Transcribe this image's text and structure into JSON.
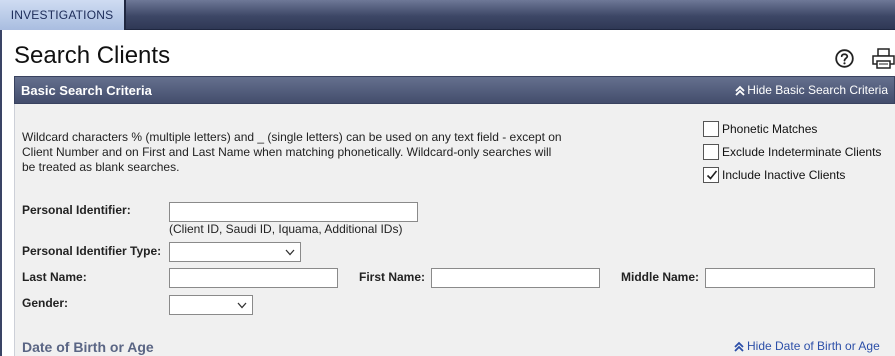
{
  "nav": {
    "tab_label": "INVESTIGATIONS"
  },
  "page": {
    "title": "Search Clients"
  },
  "icons": {
    "help": "help-circle-icon",
    "print": "printer-icon"
  },
  "basic_search": {
    "title": "Basic Search Criteria",
    "hide_label": "Hide Basic Search Criteria",
    "description": "Wildcard characters % (multiple letters) and _ (single letters) can be used on any text field - except on Client Number and on First and Last Name when matching phonetically. Wildcard-only searches will be treated as blank searches.",
    "options": [
      {
        "label": "Phonetic Matches",
        "checked": false
      },
      {
        "label": "Exclude Indeterminate Clients",
        "checked": false
      },
      {
        "label": "Include Inactive Clients",
        "checked": true
      }
    ],
    "fields": {
      "personal_identifier": {
        "label": "Personal Identifier:",
        "value": "",
        "hint": "(Client ID, Saudi ID, Iquama, Additional IDs)"
      },
      "personal_identifier_type": {
        "label": "Personal Identifier Type:",
        "value": ""
      },
      "last_name": {
        "label": "Last Name:",
        "value": ""
      },
      "first_name": {
        "label": "First Name:",
        "value": ""
      },
      "middle_name": {
        "label": "Middle Name:",
        "value": ""
      },
      "gender": {
        "label": "Gender:",
        "value": ""
      }
    }
  },
  "dob_section": {
    "title": "Date of Birth or Age",
    "hide_label": "Hide Date of Birth or Age"
  },
  "colors": {
    "header_bg": "#4a5574",
    "tab_bg": "#b8c8e6",
    "link": "#2c4fa8",
    "panel_bg": "#f0f0f0"
  }
}
